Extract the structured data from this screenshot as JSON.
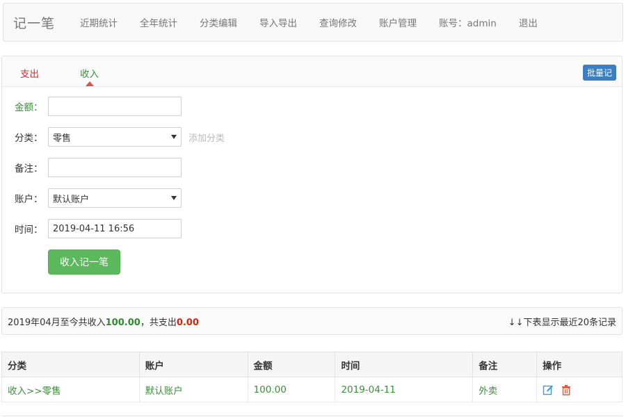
{
  "nav": {
    "brand": "记一笔",
    "items": [
      "近期统计",
      "全年统计",
      "分类编辑",
      "导入导出",
      "查询修改",
      "账户管理",
      "账号：admin",
      "退出"
    ]
  },
  "tabs": {
    "expense": "支出",
    "income": "收入",
    "active": "income"
  },
  "batch_label": "批量记",
  "form": {
    "amount_label": "金额：",
    "amount_value": "",
    "category_label": "分类：",
    "category_value": "零售",
    "add_category": "添加分类",
    "note_label": "备注：",
    "note_value": "",
    "account_label": "账户：",
    "account_value": "默认账户",
    "time_label": "时间：",
    "time_value": "2019-04-11 16:56",
    "submit": "收入记一笔"
  },
  "summary": {
    "prefix": "2019年04月至今共收入",
    "income": "100.00",
    "middle": "，共支出",
    "expense": "0.00",
    "right": "↓↓下表显示最近20条记录"
  },
  "table": {
    "headers": [
      "分类",
      "账户",
      "金额",
      "时间",
      "备注",
      "操作"
    ],
    "rows": [
      {
        "category": "收入>>零售",
        "account": "默认账户",
        "amount": "100.00",
        "time": "2019-04-11",
        "note": "外卖"
      }
    ]
  },
  "colors": {
    "income": "#3c8d3c",
    "expense": "#c9302c",
    "primary": "#3a7fc1",
    "success": "#5cb85c"
  }
}
